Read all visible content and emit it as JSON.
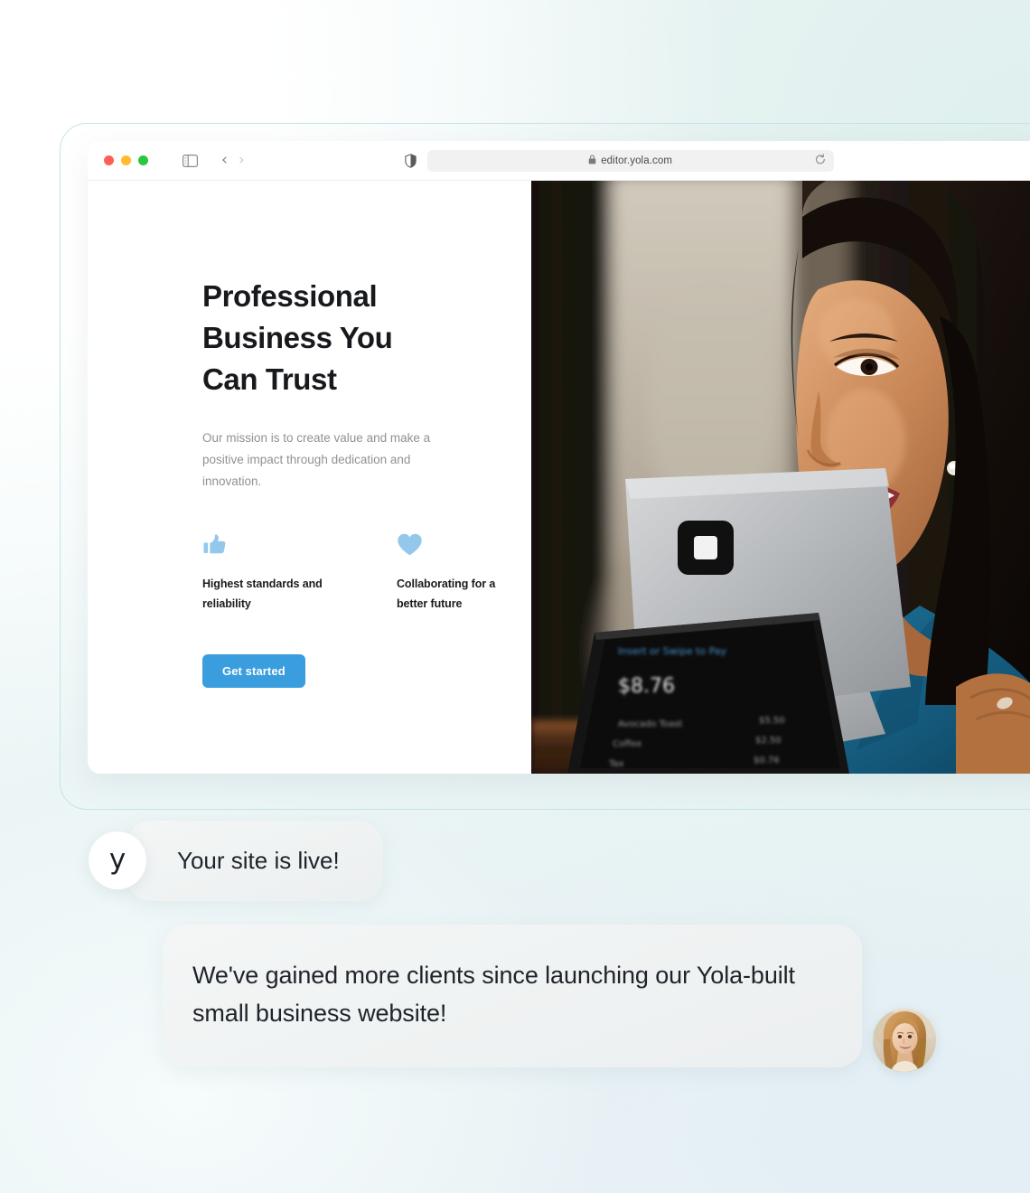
{
  "background": {
    "accent_mint": "#e7f3f2",
    "accent_blue": "#c5e3ea"
  },
  "browser": {
    "traffic_lights": [
      {
        "name": "close",
        "color": "#ff5f57"
      },
      {
        "name": "minimize",
        "color": "#febc2e"
      },
      {
        "name": "maximize",
        "color": "#28c840"
      }
    ],
    "sidebar_icon": "sidebar-toggle-icon",
    "back_icon": "chevron-left-icon",
    "forward_icon": "chevron-right-icon",
    "shield_icon": "privacy-shield-icon",
    "lock_icon": "lock-icon",
    "url": "editor.yola.com",
    "reload_icon": "reload-icon"
  },
  "hero": {
    "title": "Professional Business You Can Trust",
    "subtitle": "Our mission is to create value and make a positive impact through dedication and innovation.",
    "features": [
      {
        "icon": "thumbs-up-icon",
        "label": "Highest standards and reliability",
        "color": "#93c8ec"
      },
      {
        "icon": "heart-icon",
        "label": "Collaborating for a better future",
        "color": "#93c8ec"
      }
    ],
    "cta_label": "Get started",
    "cta_color": "#3a9ddd",
    "photo_alt": "Smiling woman in blue top holding a tablet point-of-sale terminal",
    "pos_terminal": {
      "prompt": "Insert or Swipe to Pay",
      "total": "$8.76",
      "items": [
        {
          "name": "Avocado Toast",
          "price": "$5.50"
        },
        {
          "name": "Coffee",
          "price": "$2.50"
        },
        {
          "name": "Tax",
          "price": "$0.76"
        }
      ]
    }
  },
  "chat": {
    "yola_avatar_mark": "y",
    "messages": [
      {
        "from": "yola",
        "text": "Your site is live!"
      },
      {
        "from": "client",
        "text": "We've gained more clients since launching our Yola-built small business website!"
      }
    ],
    "client_avatar_alt": "Smiling woman with light brown hair"
  }
}
